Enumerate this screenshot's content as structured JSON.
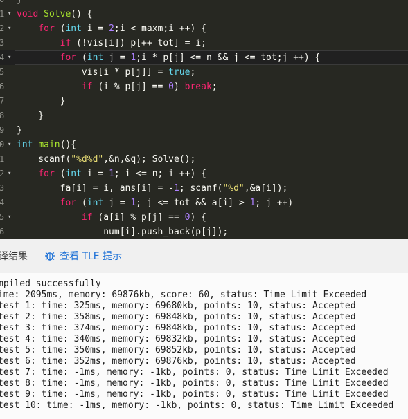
{
  "editor": {
    "lines": [
      {
        "num": "0",
        "fold": "",
        "code": "}"
      },
      {
        "num": "1",
        "fold": "▾",
        "code": "void Solve() {"
      },
      {
        "num": "2",
        "fold": "▾",
        "code": "    for (int i = 2;i < maxm;i ++) {"
      },
      {
        "num": "3",
        "fold": "",
        "code": "        if (!vis[i]) p[++ tot] = i;"
      },
      {
        "num": "4",
        "fold": "▾",
        "code": "        for (int j = 1;i * p[j] <= n && j <= tot;j ++) {"
      },
      {
        "num": "5",
        "fold": "",
        "code": "            vis[i * p[j]] = true;"
      },
      {
        "num": "6",
        "fold": "",
        "code": "            if (i % p[j] == 0) break;"
      },
      {
        "num": "7",
        "fold": "",
        "code": "        }"
      },
      {
        "num": "8",
        "fold": "",
        "code": "    }"
      },
      {
        "num": "9",
        "fold": "",
        "code": "}"
      },
      {
        "num": "0",
        "fold": "▾",
        "code": "int main(){"
      },
      {
        "num": "1",
        "fold": "",
        "code": "    scanf(\"%d%d\",&n,&q); Solve();"
      },
      {
        "num": "2",
        "fold": "▾",
        "code": "    for (int i = 1; i <= n; i ++) {"
      },
      {
        "num": "3",
        "fold": "",
        "code": "        fa[i] = i, ans[i] = -1; scanf(\"%d\",&a[i]);"
      },
      {
        "num": "4",
        "fold": "",
        "code": "        for (int j = 1; j <= tot && a[i] > 1; j ++)"
      },
      {
        "num": "5",
        "fold": "▾",
        "code": "            if (a[i] % p[j] == 0) {"
      },
      {
        "num": "6",
        "fold": "",
        "code": "                num[i].push_back(p[j]);"
      }
    ],
    "active_line_index": 4
  },
  "tabs": {
    "compile_result": "译结果",
    "tle_hint": "查看 TLE 提示",
    "tle_icon": "bug-icon"
  },
  "output": {
    "lines": [
      "mpiled successfully",
      "ime: 2095ms, memory: 69876kb, score: 60, status: Time Limit Exceeded",
      "test 1: time: 325ms, memory: 69680kb, points: 10, status: Accepted",
      "test 2: time: 358ms, memory: 69848kb, points: 10, status: Accepted",
      "test 3: time: 374ms, memory: 69848kb, points: 10, status: Accepted",
      "test 4: time: 340ms, memory: 69832kb, points: 10, status: Accepted",
      "test 5: time: 350ms, memory: 69852kb, points: 10, status: Accepted",
      "test 6: time: 352ms, memory: 69876kb, points: 10, status: Accepted",
      "test 7: time: -1ms, memory: -1kb, points: 0, status: Time Limit Exceeded",
      "test 8: time: -1ms, memory: -1kb, points: 0, status: Time Limit Exceeded",
      "test 9: time: -1ms, memory: -1kb, points: 0, status: Time Limit Exceeded",
      "test 10: time: -1ms, memory: -1kb, points: 0, status: Time Limit Exceeded"
    ]
  },
  "colors": {
    "editor_bg": "#272822",
    "keyword": "#f92672",
    "type": "#66d9ef",
    "function": "#a6e22e",
    "number": "#ae81ff",
    "string": "#e6db74",
    "link": "#1a6fd6"
  }
}
